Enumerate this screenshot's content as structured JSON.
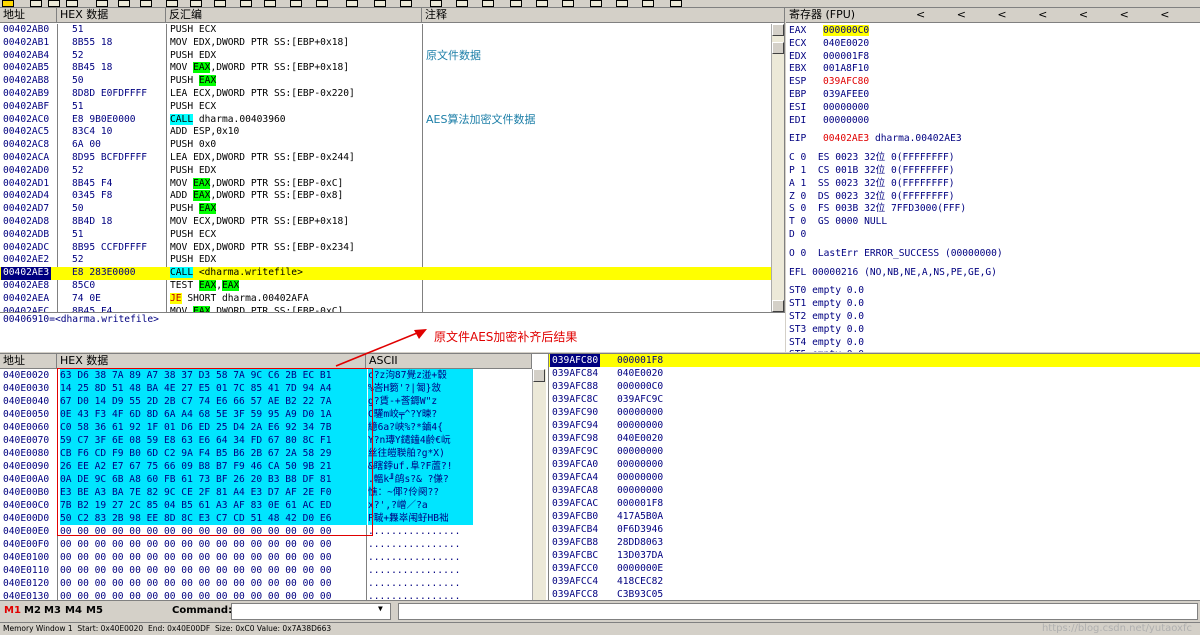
{
  "disasm": {
    "headers": {
      "address": "地址",
      "hex": "HEX 数据",
      "disasm": "反汇编",
      "comment": "注释"
    },
    "rows": [
      {
        "addr": "00402AB0",
        "hex": "51",
        "asm": [
          {
            "t": "PUSH ECX"
          }
        ]
      },
      {
        "addr": "00402AB1",
        "hex": "8B55 18",
        "asm": [
          {
            "t": "MOV EDX,DWORD PTR SS:[EBP+0x18]"
          }
        ]
      },
      {
        "addr": "00402AB4",
        "hex": "52",
        "asm": [
          {
            "t": "PUSH EDX"
          }
        ],
        "comment": "原文件数据"
      },
      {
        "addr": "00402AB5",
        "hex": "8B45 18",
        "asm": [
          {
            "t": "MOV "
          },
          {
            "t": "EAX",
            "h": "eax"
          },
          {
            "t": ",DWORD PTR SS:[EBP+0x18]"
          }
        ]
      },
      {
        "addr": "00402AB8",
        "hex": "50",
        "asm": [
          {
            "t": "PUSH "
          },
          {
            "t": "EAX",
            "h": "eax"
          }
        ]
      },
      {
        "addr": "00402AB9",
        "hex": "8D8D E0FDFFFF",
        "asm": [
          {
            "t": "LEA ECX,DWORD PTR SS:[EBP-0x220]"
          }
        ]
      },
      {
        "addr": "00402ABF",
        "hex": "51",
        "asm": [
          {
            "t": "PUSH ECX"
          }
        ]
      },
      {
        "addr": "00402AC0",
        "hex": "E8 9B0E0000",
        "asm": [
          {
            "t": "CALL",
            "h": "call"
          },
          {
            "t": " dharma.00403960"
          }
        ],
        "comment": "AES算法加密文件数据"
      },
      {
        "addr": "00402AC5",
        "hex": "83C4 10",
        "asm": [
          {
            "t": "ADD ESP,0x10"
          }
        ]
      },
      {
        "addr": "00402AC8",
        "hex": "6A 00",
        "asm": [
          {
            "t": "PUSH 0x0"
          }
        ]
      },
      {
        "addr": "00402ACA",
        "hex": "8D95 BCFDFFFF",
        "asm": [
          {
            "t": "LEA EDX,DWORD PTR SS:[EBP-0x244]"
          }
        ]
      },
      {
        "addr": "00402AD0",
        "hex": "52",
        "asm": [
          {
            "t": "PUSH EDX"
          }
        ]
      },
      {
        "addr": "00402AD1",
        "hex": "8B45 F4",
        "asm": [
          {
            "t": "MOV "
          },
          {
            "t": "EAX",
            "h": "eax"
          },
          {
            "t": ",DWORD PTR SS:[EBP-0xC]"
          }
        ]
      },
      {
        "addr": "00402AD4",
        "hex": "0345 F8",
        "asm": [
          {
            "t": "ADD "
          },
          {
            "t": "EAX",
            "h": "eax"
          },
          {
            "t": ",DWORD PTR SS:[EBP-0x8]"
          }
        ]
      },
      {
        "addr": "00402AD7",
        "hex": "50",
        "asm": [
          {
            "t": "PUSH "
          },
          {
            "t": "EAX",
            "h": "eax"
          }
        ]
      },
      {
        "addr": "00402AD8",
        "hex": "8B4D 18",
        "asm": [
          {
            "t": "MOV ECX,DWORD PTR SS:[EBP+0x18]"
          }
        ]
      },
      {
        "addr": "00402ADB",
        "hex": "51",
        "asm": [
          {
            "t": "PUSH ECX"
          }
        ]
      },
      {
        "addr": "00402ADC",
        "hex": "8B95 CCFDFFFF",
        "asm": [
          {
            "t": "MOV EDX,DWORD PTR SS:[EBP-0x234]"
          }
        ]
      },
      {
        "addr": "00402AE2",
        "hex": "52",
        "asm": [
          {
            "t": "PUSH EDX"
          }
        ]
      },
      {
        "addr": "00402AE3",
        "hex": "E8 283E0000",
        "asm": [
          {
            "t": "CALL",
            "h": "call"
          },
          {
            "t": " <dharma.writefile>"
          }
        ],
        "selected": true,
        "current": true
      },
      {
        "addr": "00402AE8",
        "hex": "85C0",
        "asm": [
          {
            "t": "TEST "
          },
          {
            "t": "EAX",
            "h": "eax"
          },
          {
            "t": ","
          },
          {
            "t": "EAX",
            "h": "eax"
          }
        ]
      },
      {
        "addr": "00402AEA",
        "hex": "74 0E",
        "asm": [
          {
            "t": "JE",
            "h": "je"
          },
          {
            "t": " SHORT dharma.00402AFA"
          }
        ]
      },
      {
        "addr": "00402AEC",
        "hex": "8B45 F4",
        "asm": [
          {
            "t": "MOV "
          },
          {
            "t": "EAX",
            "h": "eax"
          },
          {
            "t": ",DWORD PTR SS:[EBP-0xC]"
          }
        ]
      }
    ],
    "info": "00406910=<dharma.writefile>"
  },
  "registers": {
    "title": "寄存器 (FPU)",
    "arrows": "< < < < < < <",
    "general": [
      {
        "name": "EAX",
        "val": "000000C0",
        "style": "eaxhl"
      },
      {
        "name": "ECX",
        "val": "040E0020"
      },
      {
        "name": "EDX",
        "val": "000001F8"
      },
      {
        "name": "EBX",
        "val": "001A8F10"
      },
      {
        "name": "ESP",
        "val": "039AFC80",
        "style": "changed"
      },
      {
        "name": "EBP",
        "val": "039AFEE0"
      },
      {
        "name": "ESI",
        "val": "00000000"
      },
      {
        "name": "EDI",
        "val": "00000000"
      }
    ],
    "eip": {
      "name": "EIP",
      "val": "00402AE3",
      "extra": "dharma.00402AE3"
    },
    "flags": [
      "C 0  ES 0023 32位 0(FFFFFFFF)",
      "P 1  CS 001B 32位 0(FFFFFFFF)",
      "A 1  SS 0023 32位 0(FFFFFFFF)",
      "Z 0  DS 0023 32位 0(FFFFFFFF)",
      "S 0  FS 003B 32位 7FFD3000(FFF)",
      "T 0  GS 0000 NULL",
      "D 0",
      "O 0  LastErr ERROR_SUCCESS (00000000)"
    ],
    "efl": "EFL 00000216 (NO,NB,NE,A,NS,PE,GE,G)",
    "fpu": [
      "ST0 empty 0.0",
      "ST1 empty 0.0",
      "ST2 empty 0.0",
      "ST3 empty 0.0",
      "ST4 empty 0.0",
      "ST5 empty 0.0"
    ]
  },
  "dump": {
    "headers": {
      "address": "地址",
      "hex": "HEX 数据",
      "ascii": "ASCII"
    },
    "rows": [
      {
        "addr": "040E0020",
        "hex": "63 D6 38 7A 89 A7 38 37 D3 58 7A 9C C6 2B EC B1",
        "ascii": "c?z泃87覺z湴+毂",
        "hl": true
      },
      {
        "addr": "040E0030",
        "hex": "14 25 8D 51 48 BA 4E 27 E5 01 7C 85 41 7D 94 A4",
        "ascii": "%峇H篘'?|匒}敜",
        "hl": true
      },
      {
        "addr": "040E0040",
        "hex": "67 D0 14 D9 55 2D 2B C7 74 E6 66 57 AE B2 22 7A",
        "ascii": "g?賃-+莟鎒W\"z",
        "hl": true
      },
      {
        "addr": "040E0050",
        "hex": "0E 43 F3 4F 6D 8D 6A A4 68 5E 3F 59 95 A9 D0 1A",
        "ascii": "C驩m峧╤^?Y暕?",
        "hl": true
      },
      {
        "addr": "040E0060",
        "hex": "C0 58 36 61 92 1F 01 D6 ED 25 D4 2A E6 92 34 7B",
        "ascii": "繶6a?峡%?*鏀4{",
        "hl": true
      },
      {
        "addr": "040E0070",
        "hex": "59 C7 3F 6E 08 59 E8 63 E6 64 34 FD 67 80 8C F1",
        "ascii": "Y?n瑼Y鑓鎑4齡€岏",
        "hl": true
      },
      {
        "addr": "040E0080",
        "hex": "CB F6 CD F9 B0 6D C2 9A F4 B5 B6 2B 67 2A 58 29",
        "ascii": "丝往皚聫舶?g*X)",
        "hl": true
      },
      {
        "addr": "040E0090",
        "hex": "26 EE A2 E7 67 75 66 09 B8 B7 F9 46 CA 50 9B 21",
        "ascii": "&瞎鋍uf.阜?F蔖?!",
        "hl": true
      },
      {
        "addr": "040E00A0",
        "hex": "0A DE 9C 6B A8 60 FB 61 73 BF 26 20 B3 B8 DF 81",
        "ascii": ".轀k╜鹐s?& ?傔?",
        "hl": true
      },
      {
        "addr": "040E00B0",
        "hex": "E3 BE A3 BA 7E 82 9C CE 2F 81 A4 E3 D7 AF 2E F0",
        "ascii": "憔：~倻?伶阕??",
        "hl": true
      },
      {
        "addr": "040E00C0",
        "hex": "7B B2 19 27 2C 85 04 B5 61 A3 AF 83 0E 61 AC ED",
        "ascii": "x?',?嶒／?a",
        "hl": true
      },
      {
        "addr": "040E00D0",
        "hex": "50 C2 83 2B 98 EE 8D 8C E3 C7 CD 51 48 42 D0 E6",
        "ascii": "P聝+橆崒闱虸HB袦",
        "hl": true
      },
      {
        "addr": "040E00E0",
        "hex": "00 00 00 00 00 00 00 00 00 00 00 00 00 00 00 00",
        "ascii": "................"
      },
      {
        "addr": "040E00F0",
        "hex": "00 00 00 00 00 00 00 00 00 00 00 00 00 00 00 00",
        "ascii": "................"
      },
      {
        "addr": "040E0100",
        "hex": "00 00 00 00 00 00 00 00 00 00 00 00 00 00 00 00",
        "ascii": "................"
      },
      {
        "addr": "040E0110",
        "hex": "00 00 00 00 00 00 00 00 00 00 00 00 00 00 00 00",
        "ascii": "................"
      },
      {
        "addr": "040E0120",
        "hex": "00 00 00 00 00 00 00 00 00 00 00 00 00 00 00 00",
        "ascii": "................"
      },
      {
        "addr": "040E0130",
        "hex": "00 00 00 00 00 00 00 00 00 00 00 00 00 00 00 00",
        "ascii": "................"
      }
    ]
  },
  "stack": {
    "rows": [
      {
        "addr": "039AFC80",
        "val": "000001F8",
        "top": true
      },
      {
        "addr": "039AFC84",
        "val": "040E0020"
      },
      {
        "addr": "039AFC88",
        "val": "000000C0"
      },
      {
        "addr": "039AFC8C",
        "val": "039AFC9C"
      },
      {
        "addr": "039AFC90",
        "val": "00000000"
      },
      {
        "addr": "039AFC94",
        "val": "00000000"
      },
      {
        "addr": "039AFC98",
        "val": "040E0020"
      },
      {
        "addr": "039AFC9C",
        "val": "00000000"
      },
      {
        "addr": "039AFCA0",
        "val": "00000000"
      },
      {
        "addr": "039AFCA4",
        "val": "00000000"
      },
      {
        "addr": "039AFCA8",
        "val": "00000000"
      },
      {
        "addr": "039AFCAC",
        "val": "000001F8"
      },
      {
        "addr": "039AFCB0",
        "val": "417A5B0A"
      },
      {
        "addr": "039AFCB4",
        "val": "0F6D3946"
      },
      {
        "addr": "039AFCB8",
        "val": "28DD8063"
      },
      {
        "addr": "039AFCBC",
        "val": "13D037DA"
      },
      {
        "addr": "039AFCC0",
        "val": "0000000E"
      },
      {
        "addr": "039AFCC4",
        "val": "418CEC82"
      },
      {
        "addr": "039AFCC8",
        "val": "C3B93C05"
      }
    ]
  },
  "cmdbar": {
    "tabs": [
      "M1",
      "M2",
      "M3",
      "M4",
      "M5"
    ],
    "command_label": "Command:"
  },
  "status": "Memory Window 1  Start: 0x40E0020  End: 0x40E00DF  Size: 0xC0 Value: 0x7A38D663",
  "watermark": "https://blog.csdn.net/yutaoxfc",
  "annotation": "原文件AES加密补齐后结果",
  "colors": {
    "selection": "#ffff00",
    "highlight_eax": "#00ff00",
    "highlight_call": "#00ffff",
    "annotation": "#e00000",
    "dump_highlight": "#00e5ff"
  }
}
